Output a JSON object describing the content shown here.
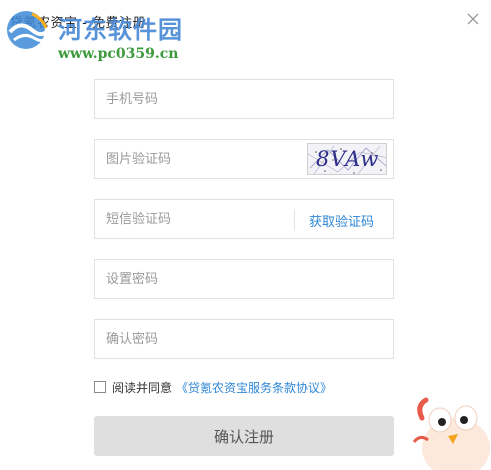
{
  "window": {
    "title": "贷氪农资宝 - 免费注册",
    "close_icon": "close-icon"
  },
  "watermark": {
    "site_name": "河东软件园",
    "url": "www.pc0359.cn",
    "logo_icon": "river-logo-icon"
  },
  "form": {
    "phone": {
      "placeholder": "手机号码",
      "value": ""
    },
    "image_code": {
      "placeholder": "图片验证码",
      "value": "",
      "captcha_text": "8VAw"
    },
    "sms_code": {
      "placeholder": "短信验证码",
      "value": "",
      "get_code_label": "获取验证码"
    },
    "password": {
      "placeholder": "设置密码",
      "value": ""
    },
    "confirm_password": {
      "placeholder": "确认密码",
      "value": ""
    },
    "agreement": {
      "checked": false,
      "label": "阅读并同意",
      "link_text": "《贷氪农资宝服务条款协议》"
    },
    "submit_label": "确认注册"
  },
  "colors": {
    "link": "#2e86d6",
    "button_bg": "#dfdfdf",
    "border": "#e1e1e1",
    "watermark_blue": "#4a8ad6",
    "watermark_green": "#3c9a3c"
  },
  "decor": {
    "mascot_icon": "cartoon-bird-mascot-icon"
  }
}
